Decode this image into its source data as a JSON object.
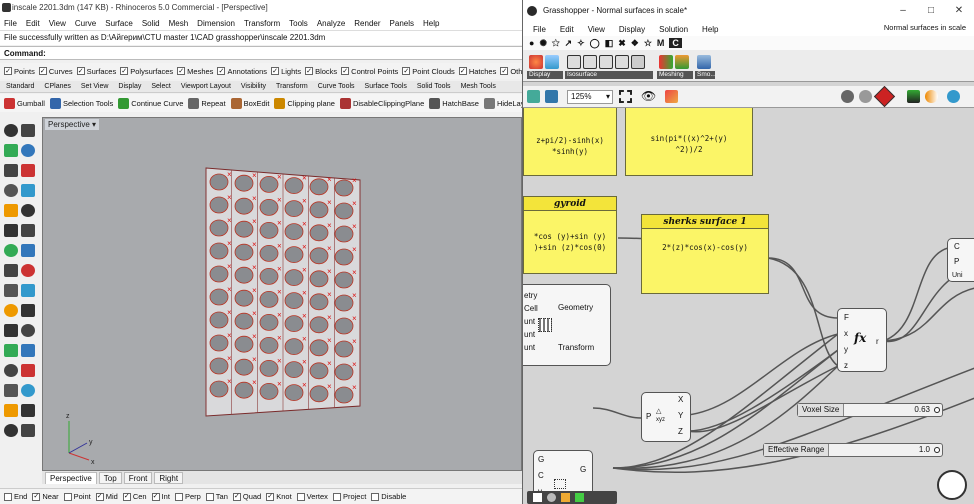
{
  "rhino": {
    "title": "inscale 2201.3dm (147 KB) - Rhinoceros 5.0 Commercial - [Perspective]",
    "menu": [
      "File",
      "Edit",
      "View",
      "Curve",
      "Surface",
      "Solid",
      "Mesh",
      "Dimension",
      "Transform",
      "Tools",
      "Analyze",
      "Render",
      "Panels",
      "Help"
    ],
    "status_line": "File successfully written as D:\\Айгерим\\CTU master 1\\CAD grasshopper\\inscale 2201.3dm",
    "command_label": "Command:",
    "filters": [
      {
        "label": "Points",
        "checked": true
      },
      {
        "label": "Curves",
        "checked": true
      },
      {
        "label": "Surfaces",
        "checked": true
      },
      {
        "label": "Polysurfaces",
        "checked": true
      },
      {
        "label": "Meshes",
        "checked": true
      },
      {
        "label": "Annotations",
        "checked": true
      },
      {
        "label": "Lights",
        "checked": true
      },
      {
        "label": "Blocks",
        "checked": true
      },
      {
        "label": "Control Points",
        "checked": true
      },
      {
        "label": "Point Clouds",
        "checked": true
      },
      {
        "label": "Hatches",
        "checked": true
      },
      {
        "label": "Other",
        "checked": true
      }
    ],
    "tabs": [
      "Standard",
      "CPlanes",
      "Set View",
      "Display",
      "Select",
      "Viewport Layout",
      "Visibility",
      "Transform",
      "Curve Tools",
      "Surface Tools",
      "Solid Tools",
      "Mesh Tools"
    ],
    "tools": [
      "Gumball",
      "Selection Tools",
      "Continue Curve",
      "Repeat",
      "BoxEdit",
      "Clipping plane",
      "DisableClippingPlane",
      "HatchBase",
      "HideLay"
    ],
    "viewport_label": "Perspective",
    "view_tabs": [
      "Perspective",
      "Top",
      "Front",
      "Right"
    ],
    "active_view": "Perspective",
    "osnaps": [
      {
        "label": "End",
        "checked": false
      },
      {
        "label": "Near",
        "checked": true
      },
      {
        "label": "Point",
        "checked": false
      },
      {
        "label": "Mid",
        "checked": true
      },
      {
        "label": "Cen",
        "checked": true
      },
      {
        "label": "Int",
        "checked": true
      },
      {
        "label": "Perp",
        "checked": false
      },
      {
        "label": "Tan",
        "checked": false
      },
      {
        "label": "Quad",
        "checked": true
      },
      {
        "label": "Knot",
        "checked": true
      },
      {
        "label": "Vertex",
        "checked": false
      },
      {
        "label": "Project",
        "checked": false
      },
      {
        "label": "Disable",
        "checked": false
      }
    ],
    "axes": {
      "x": "x",
      "y": "y",
      "z": "z"
    }
  },
  "gh": {
    "title": "Grasshopper - Normal surfaces in scale*",
    "doc_name": "Normal surfaces in scale",
    "menu": [
      "File",
      "Edit",
      "View",
      "Display",
      "Solution",
      "Help"
    ],
    "ribbon_groups": [
      "Display",
      "Isosurface",
      "Meshing",
      "Smo..."
    ],
    "zoom": "125%",
    "panels": {
      "p1": "z+pi/2)-sinh(x)\n*sinh(y)",
      "p2": "sin(pi*((x)^2+(y)\n^2))/2",
      "gyroid_title": "gyroid",
      "gyroid_body": "*cos (y)+sin (y)\n)+sin (z)*cos(0)",
      "sherks_title": "sherks surface 1",
      "sherks_body": "2*(z)*cos(x)-cos(y)"
    },
    "comp_left": {
      "inputs": [
        "etry",
        "Cell",
        "unt",
        "unt",
        "unt"
      ],
      "outputs": [
        "Geometry",
        "Transform"
      ]
    },
    "comp_expr": {
      "inputs": [
        "F",
        "x",
        "y",
        "z"
      ],
      "output": "r",
      "icon": "fx"
    },
    "comp_decon": {
      "input": "P",
      "outputs": [
        "X",
        "Y",
        "Z"
      ],
      "label": "xyz"
    },
    "comp_bottom": {
      "inputs": [
        "G",
        "C",
        "v"
      ],
      "output": "G"
    },
    "comp_right": {
      "inputs": [
        "C",
        "P"
      ],
      "label": "Uni"
    },
    "sliders": [
      {
        "label": "Voxel Size",
        "value": "0.63",
        "fill": 0.63
      },
      {
        "label": "Effective Range",
        "value": "1.0",
        "fill": 1.0
      }
    ]
  }
}
